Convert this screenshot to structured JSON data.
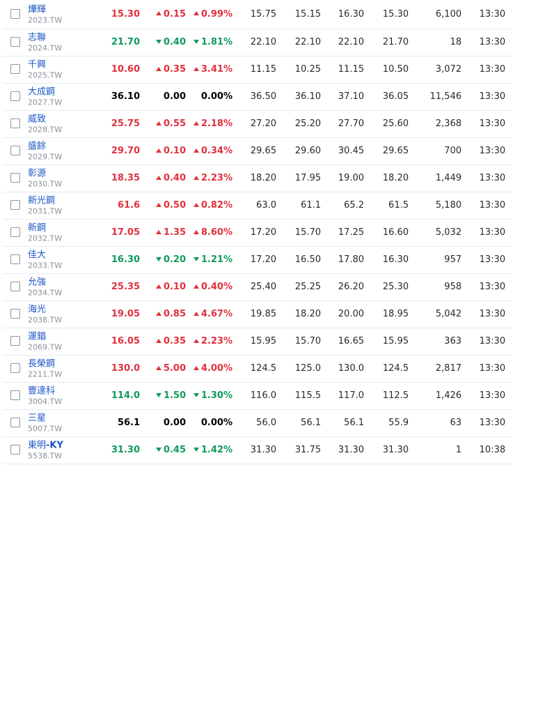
{
  "colors": {
    "up": "#e0313e",
    "down": "#0f9a5a",
    "flat": "#000000",
    "link": "#1d56c5"
  },
  "icons": {
    "up": "triangle-up-icon",
    "down": "triangle-down-icon"
  },
  "rows": [
    {
      "name": "燁輝",
      "symbol": "2023.TW",
      "price": "15.30",
      "change": "0.15",
      "pct": "0.99%",
      "dir": "up",
      "open": "15.75",
      "prev": "15.15",
      "high": "16.30",
      "low": "15.30",
      "volume": "6,100",
      "time": "13:30"
    },
    {
      "name": "志聯",
      "symbol": "2024.TW",
      "price": "21.70",
      "change": "0.40",
      "pct": "1.81%",
      "dir": "down",
      "open": "22.10",
      "prev": "22.10",
      "high": "22.10",
      "low": "21.70",
      "volume": "18",
      "time": "13:30"
    },
    {
      "name": "千興",
      "symbol": "2025.TW",
      "price": "10.60",
      "change": "0.35",
      "pct": "3.41%",
      "dir": "up",
      "open": "11.15",
      "prev": "10.25",
      "high": "11.15",
      "low": "10.50",
      "volume": "3,072",
      "time": "13:30"
    },
    {
      "name": "大成鋼",
      "symbol": "2027.TW",
      "price": "36.10",
      "change": "0.00",
      "pct": "0.00%",
      "dir": "flat",
      "open": "36.50",
      "prev": "36.10",
      "high": "37.10",
      "low": "36.05",
      "volume": "11,546",
      "time": "13:30"
    },
    {
      "name": "威致",
      "symbol": "2028.TW",
      "price": "25.75",
      "change": "0.55",
      "pct": "2.18%",
      "dir": "up",
      "open": "27.20",
      "prev": "25.20",
      "high": "27.70",
      "low": "25.60",
      "volume": "2,368",
      "time": "13:30"
    },
    {
      "name": "盛餘",
      "symbol": "2029.TW",
      "price": "29.70",
      "change": "0.10",
      "pct": "0.34%",
      "dir": "up",
      "open": "29.65",
      "prev": "29.60",
      "high": "30.45",
      "low": "29.65",
      "volume": "700",
      "time": "13:30"
    },
    {
      "name": "彰源",
      "symbol": "2030.TW",
      "price": "18.35",
      "change": "0.40",
      "pct": "2.23%",
      "dir": "up",
      "open": "18.20",
      "prev": "17.95",
      "high": "19.00",
      "low": "18.20",
      "volume": "1,449",
      "time": "13:30"
    },
    {
      "name": "新光鋼",
      "symbol": "2031.TW",
      "price": "61.6",
      "change": "0.50",
      "pct": "0.82%",
      "dir": "up",
      "open": "63.0",
      "prev": "61.1",
      "high": "65.2",
      "low": "61.5",
      "volume": "5,180",
      "time": "13:30"
    },
    {
      "name": "新鋼",
      "symbol": "2032.TW",
      "price": "17.05",
      "change": "1.35",
      "pct": "8.60%",
      "dir": "up",
      "open": "17.20",
      "prev": "15.70",
      "high": "17.25",
      "low": "16.60",
      "volume": "5,032",
      "time": "13:30"
    },
    {
      "name": "佳大",
      "symbol": "2033.TW",
      "price": "16.30",
      "change": "0.20",
      "pct": "1.21%",
      "dir": "down",
      "open": "17.20",
      "prev": "16.50",
      "high": "17.80",
      "low": "16.30",
      "volume": "957",
      "time": "13:30"
    },
    {
      "name": "允強",
      "symbol": "2034.TW",
      "price": "25.35",
      "change": "0.10",
      "pct": "0.40%",
      "dir": "up",
      "open": "25.40",
      "prev": "25.25",
      "high": "26.20",
      "low": "25.30",
      "volume": "958",
      "time": "13:30"
    },
    {
      "name": "海光",
      "symbol": "2038.TW",
      "price": "19.05",
      "change": "0.85",
      "pct": "4.67%",
      "dir": "up",
      "open": "19.85",
      "prev": "18.20",
      "high": "20.00",
      "low": "18.95",
      "volume": "5,042",
      "time": "13:30"
    },
    {
      "name": "運錩",
      "symbol": "2069.TW",
      "price": "16.05",
      "change": "0.35",
      "pct": "2.23%",
      "dir": "up",
      "open": "15.95",
      "prev": "15.70",
      "high": "16.65",
      "low": "15.95",
      "volume": "363",
      "time": "13:30"
    },
    {
      "name": "長榮鋼",
      "symbol": "2211.TW",
      "price": "130.0",
      "change": "5.00",
      "pct": "4.00%",
      "dir": "up",
      "open": "124.5",
      "prev": "125.0",
      "high": "130.0",
      "low": "124.5",
      "volume": "2,817",
      "time": "13:30"
    },
    {
      "name": "豐達科",
      "symbol": "3004.TW",
      "price": "114.0",
      "change": "1.50",
      "pct": "1.30%",
      "dir": "down",
      "open": "116.0",
      "prev": "115.5",
      "high": "117.0",
      "low": "112.5",
      "volume": "1,426",
      "time": "13:30"
    },
    {
      "name": "三星",
      "symbol": "5007.TW",
      "price": "56.1",
      "change": "0.00",
      "pct": "0.00%",
      "dir": "flat",
      "open": "56.0",
      "prev": "56.1",
      "high": "56.1",
      "low": "55.9",
      "volume": "63",
      "time": "13:30"
    },
    {
      "name": "東明",
      "name_suffix": "-KY",
      "symbol": "5538.TW",
      "price": "31.30",
      "change": "0.45",
      "pct": "1.42%",
      "dir": "down",
      "open": "31.30",
      "prev": "31.75",
      "high": "31.30",
      "low": "31.30",
      "volume": "1",
      "time": "10:38"
    }
  ]
}
